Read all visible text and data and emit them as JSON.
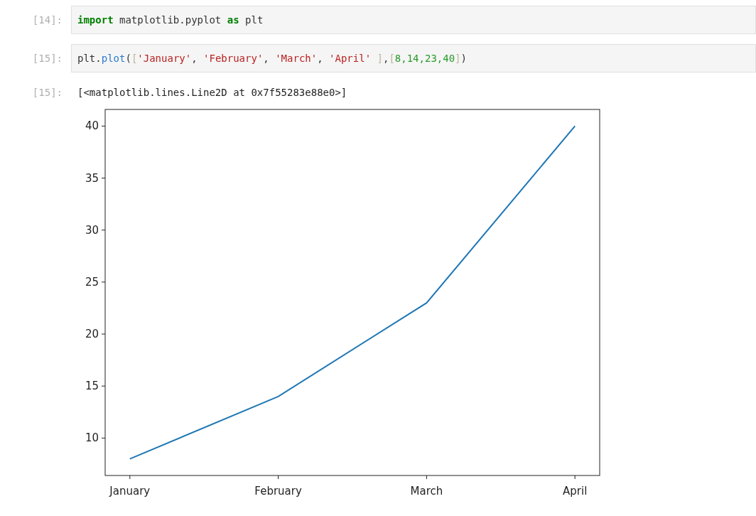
{
  "cells": [
    {
      "kind": "input",
      "prompt": "[14]:",
      "tokens": [
        {
          "text": "import",
          "kind": "keyword"
        },
        {
          "text": " matplotlib.pyplot ",
          "kind": "plain"
        },
        {
          "text": "as",
          "kind": "keyword"
        },
        {
          "text": " plt",
          "kind": "plain"
        }
      ]
    },
    {
      "kind": "input",
      "prompt": "[15]:",
      "tokens": [
        {
          "text": "plt.",
          "kind": "plain"
        },
        {
          "text": "plot",
          "kind": "function"
        },
        {
          "text": "(",
          "kind": "plain"
        },
        {
          "text": "[",
          "kind": "bracket"
        },
        {
          "text": "'January'",
          "kind": "string"
        },
        {
          "text": ", ",
          "kind": "plain"
        },
        {
          "text": "'February'",
          "kind": "string"
        },
        {
          "text": ", ",
          "kind": "plain"
        },
        {
          "text": "'March'",
          "kind": "string"
        },
        {
          "text": ", ",
          "kind": "plain"
        },
        {
          "text": "'April'",
          "kind": "string"
        },
        {
          "text": " ]",
          "kind": "bracket"
        },
        {
          "text": ",",
          "kind": "plain"
        },
        {
          "text": "[",
          "kind": "bracket"
        },
        {
          "text": "8,14,23,40",
          "kind": "number"
        },
        {
          "text": "]",
          "kind": "bracket"
        },
        {
          "text": ")",
          "kind": "plain"
        }
      ]
    },
    {
      "kind": "output",
      "prompt": "[15]:",
      "text": "[<matplotlib.lines.Line2D at 0x7f55283e88e0>]",
      "chart_data": {
        "type": "line",
        "categories": [
          "January",
          "February",
          "March",
          "April"
        ],
        "series": [
          {
            "color": "#1f77b4",
            "values": [
              8,
              14,
              23,
              40
            ]
          }
        ],
        "ylim": [
          6.4,
          41.6
        ],
        "yticks": [
          10,
          15,
          20,
          25,
          30,
          35,
          40
        ]
      }
    }
  ]
}
